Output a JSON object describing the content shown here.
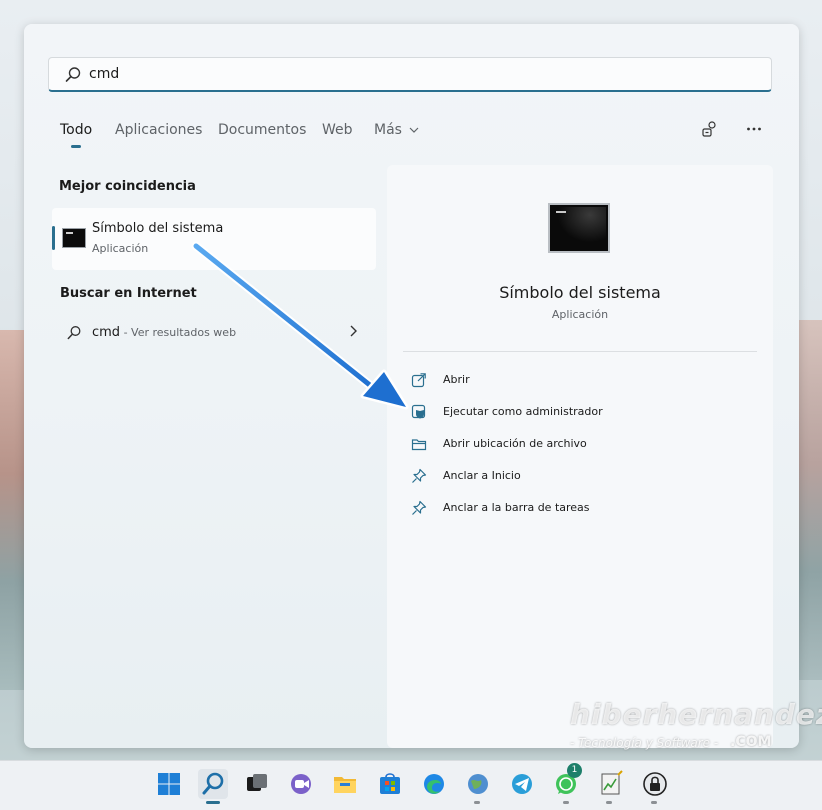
{
  "search": {
    "query": "cmd"
  },
  "tabs": [
    {
      "label": "Todo",
      "active": true
    },
    {
      "label": "Aplicaciones"
    },
    {
      "label": "Documentos"
    },
    {
      "label": "Web"
    },
    {
      "label": "Más"
    }
  ],
  "top_icons": [
    "share-accounts-icon",
    "more-options-icon"
  ],
  "best_match": {
    "heading": "Mejor coincidencia",
    "title": "Símbolo del sistema",
    "subtitle": "Aplicación",
    "icon": "command-prompt-icon"
  },
  "internet": {
    "heading": "Buscar en Internet",
    "query": "cmd",
    "sub": " - Ver resultados web"
  },
  "detail": {
    "title": "Símbolo del sistema",
    "subtitle": "Aplicación",
    "actions": [
      {
        "label": "Abrir",
        "icon": "open-external-icon"
      },
      {
        "label": "Ejecutar como administrador",
        "icon": "shield-admin-icon"
      },
      {
        "label": "Abrir ubicación de archivo",
        "icon": "folder-icon"
      },
      {
        "label": "Anclar a Inicio",
        "icon": "pin-icon"
      },
      {
        "label": "Anclar a la barra de tareas",
        "icon": "pin-icon"
      }
    ]
  },
  "taskbar": {
    "apps": [
      "start-icon",
      "search-icon",
      "task-view-icon",
      "teams-chat-icon",
      "file-explorer-icon",
      "store-icon",
      "edge-icon",
      "network-globe-icon",
      "telegram-icon",
      "whatsapp-icon",
      "notepad-chart-icon",
      "lock-app-icon"
    ],
    "whatsapp_badge": "1"
  },
  "watermark": {
    "main": "hiberhernandez",
    "sub": "- Tecnología y Software -",
    "com": ".COM"
  },
  "colors": {
    "accent": "#2a6f8f",
    "arrow": "#1e88e5"
  }
}
